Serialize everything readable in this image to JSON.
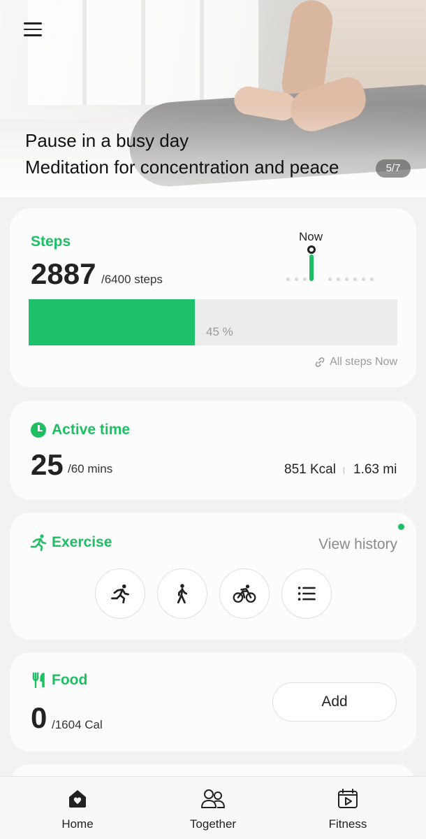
{
  "hero": {
    "title": "Pause in a busy day",
    "subtitle": "Meditation for concentration and peace",
    "pager": "5/7"
  },
  "steps": {
    "title": "Steps",
    "count": "2887",
    "goal": "/6400 steps",
    "now_label": "Now",
    "progress_fraction": 0.45,
    "progress_label": "45 %",
    "link_label": "All steps Now"
  },
  "active_time": {
    "title": "Active time",
    "count": "25",
    "goal": "/60 mins",
    "kcal": "851 Kcal",
    "distance": "1.63 mi"
  },
  "exercise": {
    "title": "Exercise",
    "view_history": "View history",
    "buttons": [
      "running-icon",
      "walking-icon",
      "cycling-icon",
      "list-icon"
    ]
  },
  "food": {
    "title": "Food",
    "count": "0",
    "goal": "/1604 Cal",
    "add_label": "Add"
  },
  "nav": {
    "items": [
      {
        "label": "Home",
        "icon": "home-icon"
      },
      {
        "label": "Together",
        "icon": "people-icon"
      },
      {
        "label": "Fitness",
        "icon": "fitness-icon"
      }
    ]
  },
  "colors": {
    "accent": "#1dbf63",
    "background": "#f2f2f2",
    "card": "#fcfcfc"
  }
}
